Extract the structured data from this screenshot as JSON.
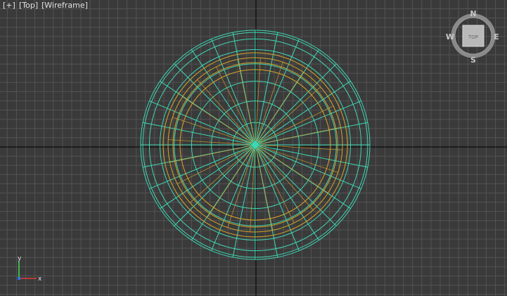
{
  "viewport": {
    "menu_plus": "[+]",
    "view_label": "[Top]",
    "shading_label": "[Wireframe]"
  },
  "viewcube": {
    "face_label": "TOP",
    "north": "N",
    "south": "S",
    "east": "E",
    "west": "W"
  },
  "axis_gizmo": {
    "y_label": "y",
    "x_label": "x"
  },
  "wireframe": {
    "sphere_color": "#3fd6b3",
    "inner_color": "#d9a429",
    "radial_segments": 32,
    "latitude_rings": 8
  },
  "colors": {
    "background": "#3a3a3a",
    "grid_minor": "#535353",
    "grid_major": "#000000"
  }
}
